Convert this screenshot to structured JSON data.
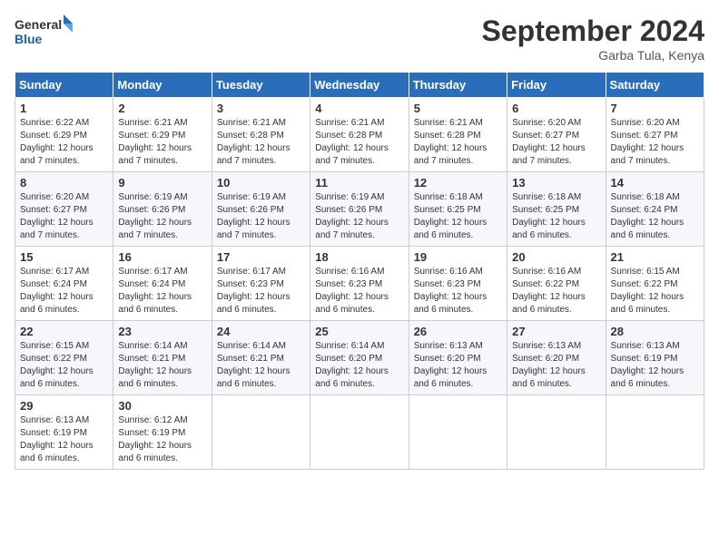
{
  "logo": {
    "line1": "General",
    "line2": "Blue"
  },
  "title": "September 2024",
  "subtitle": "Garba Tula, Kenya",
  "days_of_week": [
    "Sunday",
    "Monday",
    "Tuesday",
    "Wednesday",
    "Thursday",
    "Friday",
    "Saturday"
  ],
  "weeks": [
    [
      {
        "day": "1",
        "sunrise": "6:22 AM",
        "sunset": "6:29 PM",
        "daylight": "12 hours and 7 minutes."
      },
      {
        "day": "2",
        "sunrise": "6:21 AM",
        "sunset": "6:29 PM",
        "daylight": "12 hours and 7 minutes."
      },
      {
        "day": "3",
        "sunrise": "6:21 AM",
        "sunset": "6:28 PM",
        "daylight": "12 hours and 7 minutes."
      },
      {
        "day": "4",
        "sunrise": "6:21 AM",
        "sunset": "6:28 PM",
        "daylight": "12 hours and 7 minutes."
      },
      {
        "day": "5",
        "sunrise": "6:21 AM",
        "sunset": "6:28 PM",
        "daylight": "12 hours and 7 minutes."
      },
      {
        "day": "6",
        "sunrise": "6:20 AM",
        "sunset": "6:27 PM",
        "daylight": "12 hours and 7 minutes."
      },
      {
        "day": "7",
        "sunrise": "6:20 AM",
        "sunset": "6:27 PM",
        "daylight": "12 hours and 7 minutes."
      }
    ],
    [
      {
        "day": "8",
        "sunrise": "6:20 AM",
        "sunset": "6:27 PM",
        "daylight": "12 hours and 7 minutes."
      },
      {
        "day": "9",
        "sunrise": "6:19 AM",
        "sunset": "6:26 PM",
        "daylight": "12 hours and 7 minutes."
      },
      {
        "day": "10",
        "sunrise": "6:19 AM",
        "sunset": "6:26 PM",
        "daylight": "12 hours and 7 minutes."
      },
      {
        "day": "11",
        "sunrise": "6:19 AM",
        "sunset": "6:26 PM",
        "daylight": "12 hours and 7 minutes."
      },
      {
        "day": "12",
        "sunrise": "6:18 AM",
        "sunset": "6:25 PM",
        "daylight": "12 hours and 6 minutes."
      },
      {
        "day": "13",
        "sunrise": "6:18 AM",
        "sunset": "6:25 PM",
        "daylight": "12 hours and 6 minutes."
      },
      {
        "day": "14",
        "sunrise": "6:18 AM",
        "sunset": "6:24 PM",
        "daylight": "12 hours and 6 minutes."
      }
    ],
    [
      {
        "day": "15",
        "sunrise": "6:17 AM",
        "sunset": "6:24 PM",
        "daylight": "12 hours and 6 minutes."
      },
      {
        "day": "16",
        "sunrise": "6:17 AM",
        "sunset": "6:24 PM",
        "daylight": "12 hours and 6 minutes."
      },
      {
        "day": "17",
        "sunrise": "6:17 AM",
        "sunset": "6:23 PM",
        "daylight": "12 hours and 6 minutes."
      },
      {
        "day": "18",
        "sunrise": "6:16 AM",
        "sunset": "6:23 PM",
        "daylight": "12 hours and 6 minutes."
      },
      {
        "day": "19",
        "sunrise": "6:16 AM",
        "sunset": "6:23 PM",
        "daylight": "12 hours and 6 minutes."
      },
      {
        "day": "20",
        "sunrise": "6:16 AM",
        "sunset": "6:22 PM",
        "daylight": "12 hours and 6 minutes."
      },
      {
        "day": "21",
        "sunrise": "6:15 AM",
        "sunset": "6:22 PM",
        "daylight": "12 hours and 6 minutes."
      }
    ],
    [
      {
        "day": "22",
        "sunrise": "6:15 AM",
        "sunset": "6:22 PM",
        "daylight": "12 hours and 6 minutes."
      },
      {
        "day": "23",
        "sunrise": "6:14 AM",
        "sunset": "6:21 PM",
        "daylight": "12 hours and 6 minutes."
      },
      {
        "day": "24",
        "sunrise": "6:14 AM",
        "sunset": "6:21 PM",
        "daylight": "12 hours and 6 minutes."
      },
      {
        "day": "25",
        "sunrise": "6:14 AM",
        "sunset": "6:20 PM",
        "daylight": "12 hours and 6 minutes."
      },
      {
        "day": "26",
        "sunrise": "6:13 AM",
        "sunset": "6:20 PM",
        "daylight": "12 hours and 6 minutes."
      },
      {
        "day": "27",
        "sunrise": "6:13 AM",
        "sunset": "6:20 PM",
        "daylight": "12 hours and 6 minutes."
      },
      {
        "day": "28",
        "sunrise": "6:13 AM",
        "sunset": "6:19 PM",
        "daylight": "12 hours and 6 minutes."
      }
    ],
    [
      {
        "day": "29",
        "sunrise": "6:13 AM",
        "sunset": "6:19 PM",
        "daylight": "12 hours and 6 minutes."
      },
      {
        "day": "30",
        "sunrise": "6:12 AM",
        "sunset": "6:19 PM",
        "daylight": "12 hours and 6 minutes."
      },
      null,
      null,
      null,
      null,
      null
    ]
  ]
}
